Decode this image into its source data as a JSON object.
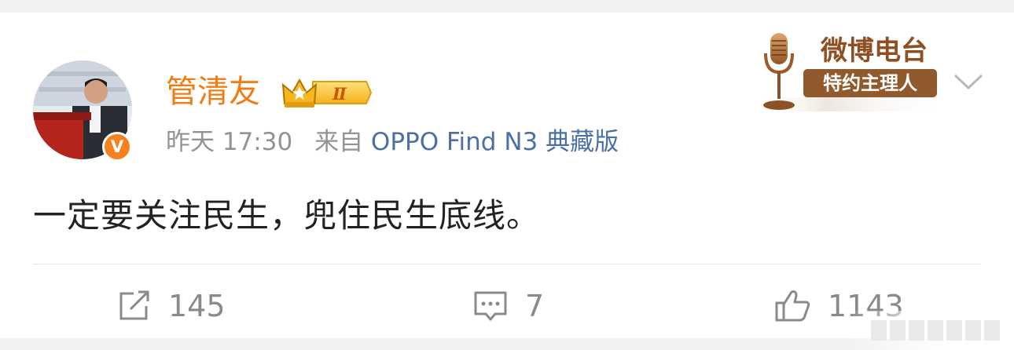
{
  "post": {
    "author": "管清友",
    "vip_level": "Ⅱ",
    "verified_mark": "V",
    "time": "昨天 17:30",
    "source_prefix": "来自",
    "source_device": "OPPO Find N3 典藏版",
    "text": "一定要关注民生，兜住民生底线。"
  },
  "badge": {
    "title": "微博电台",
    "subtitle": "特约主理人"
  },
  "actions": {
    "repost_count": "145",
    "comment_count": "7",
    "like_count": "1143"
  },
  "icons": {
    "avatar": "avatar-photo",
    "verified": "verified-v-icon",
    "vip": "crown-icon",
    "radio": "microphone-icon",
    "menu": "chevron-down-icon",
    "repost": "share-icon",
    "comment": "comment-icon",
    "like": "thumbs-up-icon"
  },
  "colors": {
    "username": "#f07c14",
    "source_link": "#4c6fa6",
    "verified_badge": "#f58220",
    "meta_text": "#939393",
    "body_text": "#222222",
    "action_text": "#8a8a8a"
  }
}
